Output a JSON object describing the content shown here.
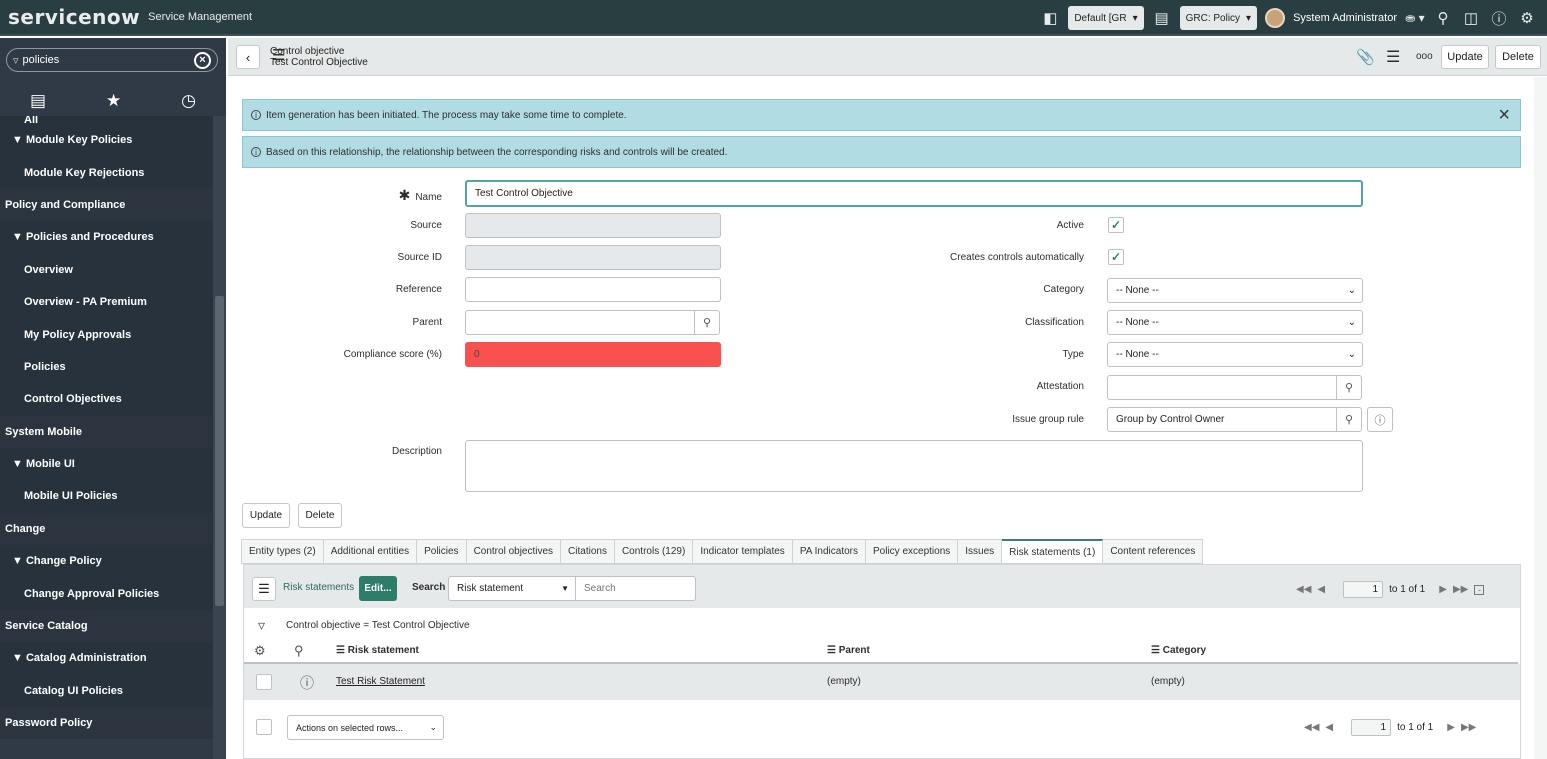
{
  "banner": {
    "logo": "servicenow",
    "product": "Service Management",
    "update_set": "Default [GR",
    "scope": "GRC: Policy",
    "user": "System Administrator",
    "icons": [
      "connect-icon",
      "update-set-icon",
      "search-icon",
      "chat-icon",
      "help-icon",
      "gear-icon"
    ]
  },
  "sidebar": {
    "filter_value": "policies",
    "items": [
      {
        "label": "All",
        "level": "all"
      },
      {
        "label": "▼ Module Key Policies",
        "level": "module"
      },
      {
        "label": "Module Key Rejections",
        "level": "child"
      },
      {
        "label": "Policy and Compliance",
        "level": "section"
      },
      {
        "label": "▼ Policies and Procedures",
        "level": "module"
      },
      {
        "label": "Overview",
        "level": "child"
      },
      {
        "label": "Overview - PA Premium",
        "level": "child"
      },
      {
        "label": "My Policy Approvals",
        "level": "child"
      },
      {
        "label": "Policies",
        "level": "child"
      },
      {
        "label": "Control Objectives",
        "level": "child"
      },
      {
        "label": "System Mobile",
        "level": "section"
      },
      {
        "label": "▼ Mobile UI",
        "level": "module"
      },
      {
        "label": "Mobile UI Policies",
        "level": "child"
      },
      {
        "label": "Change",
        "level": "section"
      },
      {
        "label": "▼ Change Policy",
        "level": "module"
      },
      {
        "label": "Change Approval Policies",
        "level": "child"
      },
      {
        "label": "Service Catalog",
        "level": "section"
      },
      {
        "label": "▼ Catalog Administration",
        "level": "module"
      },
      {
        "label": "Catalog UI Policies",
        "level": "child"
      },
      {
        "label": "Password Policy",
        "level": "section"
      }
    ]
  },
  "header": {
    "table_label": "Control objective",
    "record_name": "Test Control Objective",
    "update_label": "Update",
    "delete_label": "Delete",
    "more_label": "ooo"
  },
  "messages": {
    "msg1": "Item generation has been initiated. The process may take some time to complete.",
    "msg2": "Based on this relationship, the relationship between the corresponding risks and controls will be created."
  },
  "form": {
    "name_label": "Name",
    "name_value": "Test Control Objective",
    "source_label": "Source",
    "source_id_label": "Source ID",
    "reference_label": "Reference",
    "parent_label": "Parent",
    "score_label": "Compliance score (%)",
    "score_value": "0",
    "description_label": "Description",
    "active_label": "Active",
    "creates_label": "Creates controls automatically",
    "category_label": "Category",
    "category_value": "-- None --",
    "classification_label": "Classification",
    "classification_value": "-- None --",
    "type_label": "Type",
    "type_value": "-- None --",
    "attestation_label": "Attestation",
    "issue_rule_label": "Issue group rule",
    "issue_rule_value": "Group by Control Owner",
    "update_label": "Update",
    "delete_label": "Delete"
  },
  "related_tabs": [
    "Entity types (2)",
    "Additional entities",
    "Policies",
    "Control objectives",
    "Citations",
    "Controls (129)",
    "Indicator templates",
    "PA Indicators",
    "Policy exceptions",
    "Issues",
    "Risk statements (1)",
    "Content references"
  ],
  "related_list": {
    "title": "Risk statements",
    "edit_label": "Edit...",
    "search_label": "Search",
    "search_field": "Risk statement",
    "search_placeholder": "Search",
    "page_value": "1",
    "page_of": "to 1 of 1",
    "breadcrumb": "Control objective = Test Control Objective",
    "columns": [
      "Risk statement",
      "Parent",
      "Category"
    ],
    "rows": [
      {
        "statement": "Test Risk Statement",
        "parent": "(empty)",
        "category": "(empty)"
      }
    ],
    "actions_label": "Actions on selected rows..."
  },
  "colors": {
    "banner": "#293e40",
    "sidebar": "#303a46",
    "accent": "#278efc",
    "error": "#f95050",
    "info_message": "#b1dce4",
    "edit_button": "#2e7d6b"
  }
}
